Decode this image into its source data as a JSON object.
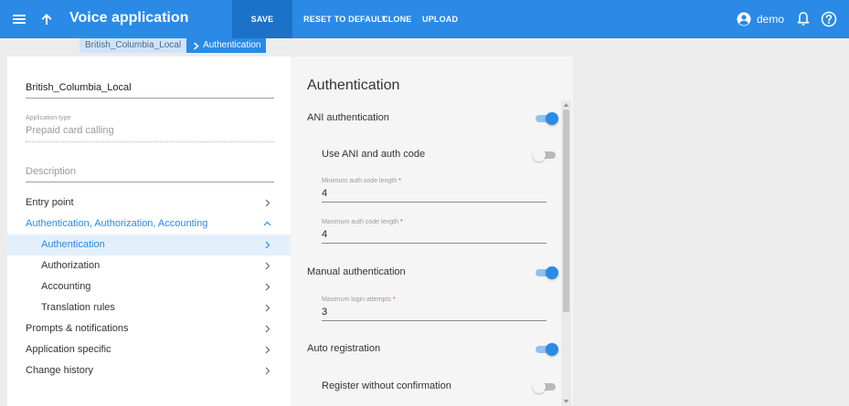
{
  "topbar": {
    "menu_icon": "hamburger-menu-icon",
    "back_icon": "arrow-up-icon",
    "title": "Voice application",
    "save_label": "SAVE",
    "reset_label": "RESET TO DEFAULT",
    "clone_label": "CLONE",
    "upload_label": "UPLOAD",
    "user_icon": "user-circle-icon",
    "user_name": "demo",
    "bell_icon": "bell-icon",
    "help_icon": "help-circle-icon",
    "accent_color": "#2a8ae6"
  },
  "breadcrumb": {
    "items": [
      {
        "label": "British_Columbia_Local"
      },
      {
        "label": "Authentication"
      }
    ]
  },
  "left": {
    "name_value": "British_Columbia_Local",
    "app_type_label": "Application type",
    "app_type_value": "Prepaid card calling",
    "description_placeholder": "Description",
    "nav": [
      {
        "label": "Entry point"
      },
      {
        "label": "Authentication, Authorization, Accounting"
      },
      {
        "label": "Authentication"
      },
      {
        "label": "Authorization"
      },
      {
        "label": "Accounting"
      },
      {
        "label": "Translation rules"
      },
      {
        "label": "Prompts & notifications"
      },
      {
        "label": "Application specific"
      },
      {
        "label": "Change history"
      }
    ]
  },
  "auth": {
    "title": "Authentication",
    "ani_auth_label": "ANI authentication",
    "ani_auth_on": true,
    "use_ani_label": "Use ANI and auth code",
    "use_ani_on": false,
    "min_len_label": "Minimum auth code length",
    "min_len_value": "4",
    "max_len_label": "Maximum auth code length",
    "max_len_value": "4",
    "manual_auth_label": "Manual authentication",
    "manual_auth_on": true,
    "max_attempts_label": "Maximum login attempts",
    "max_attempts_value": "3",
    "auto_reg_label": "Auto registration",
    "auto_reg_on": true,
    "reg_no_confirm_label": "Register without confirmation",
    "reg_no_confirm_on": false,
    "required_mark": "*"
  }
}
